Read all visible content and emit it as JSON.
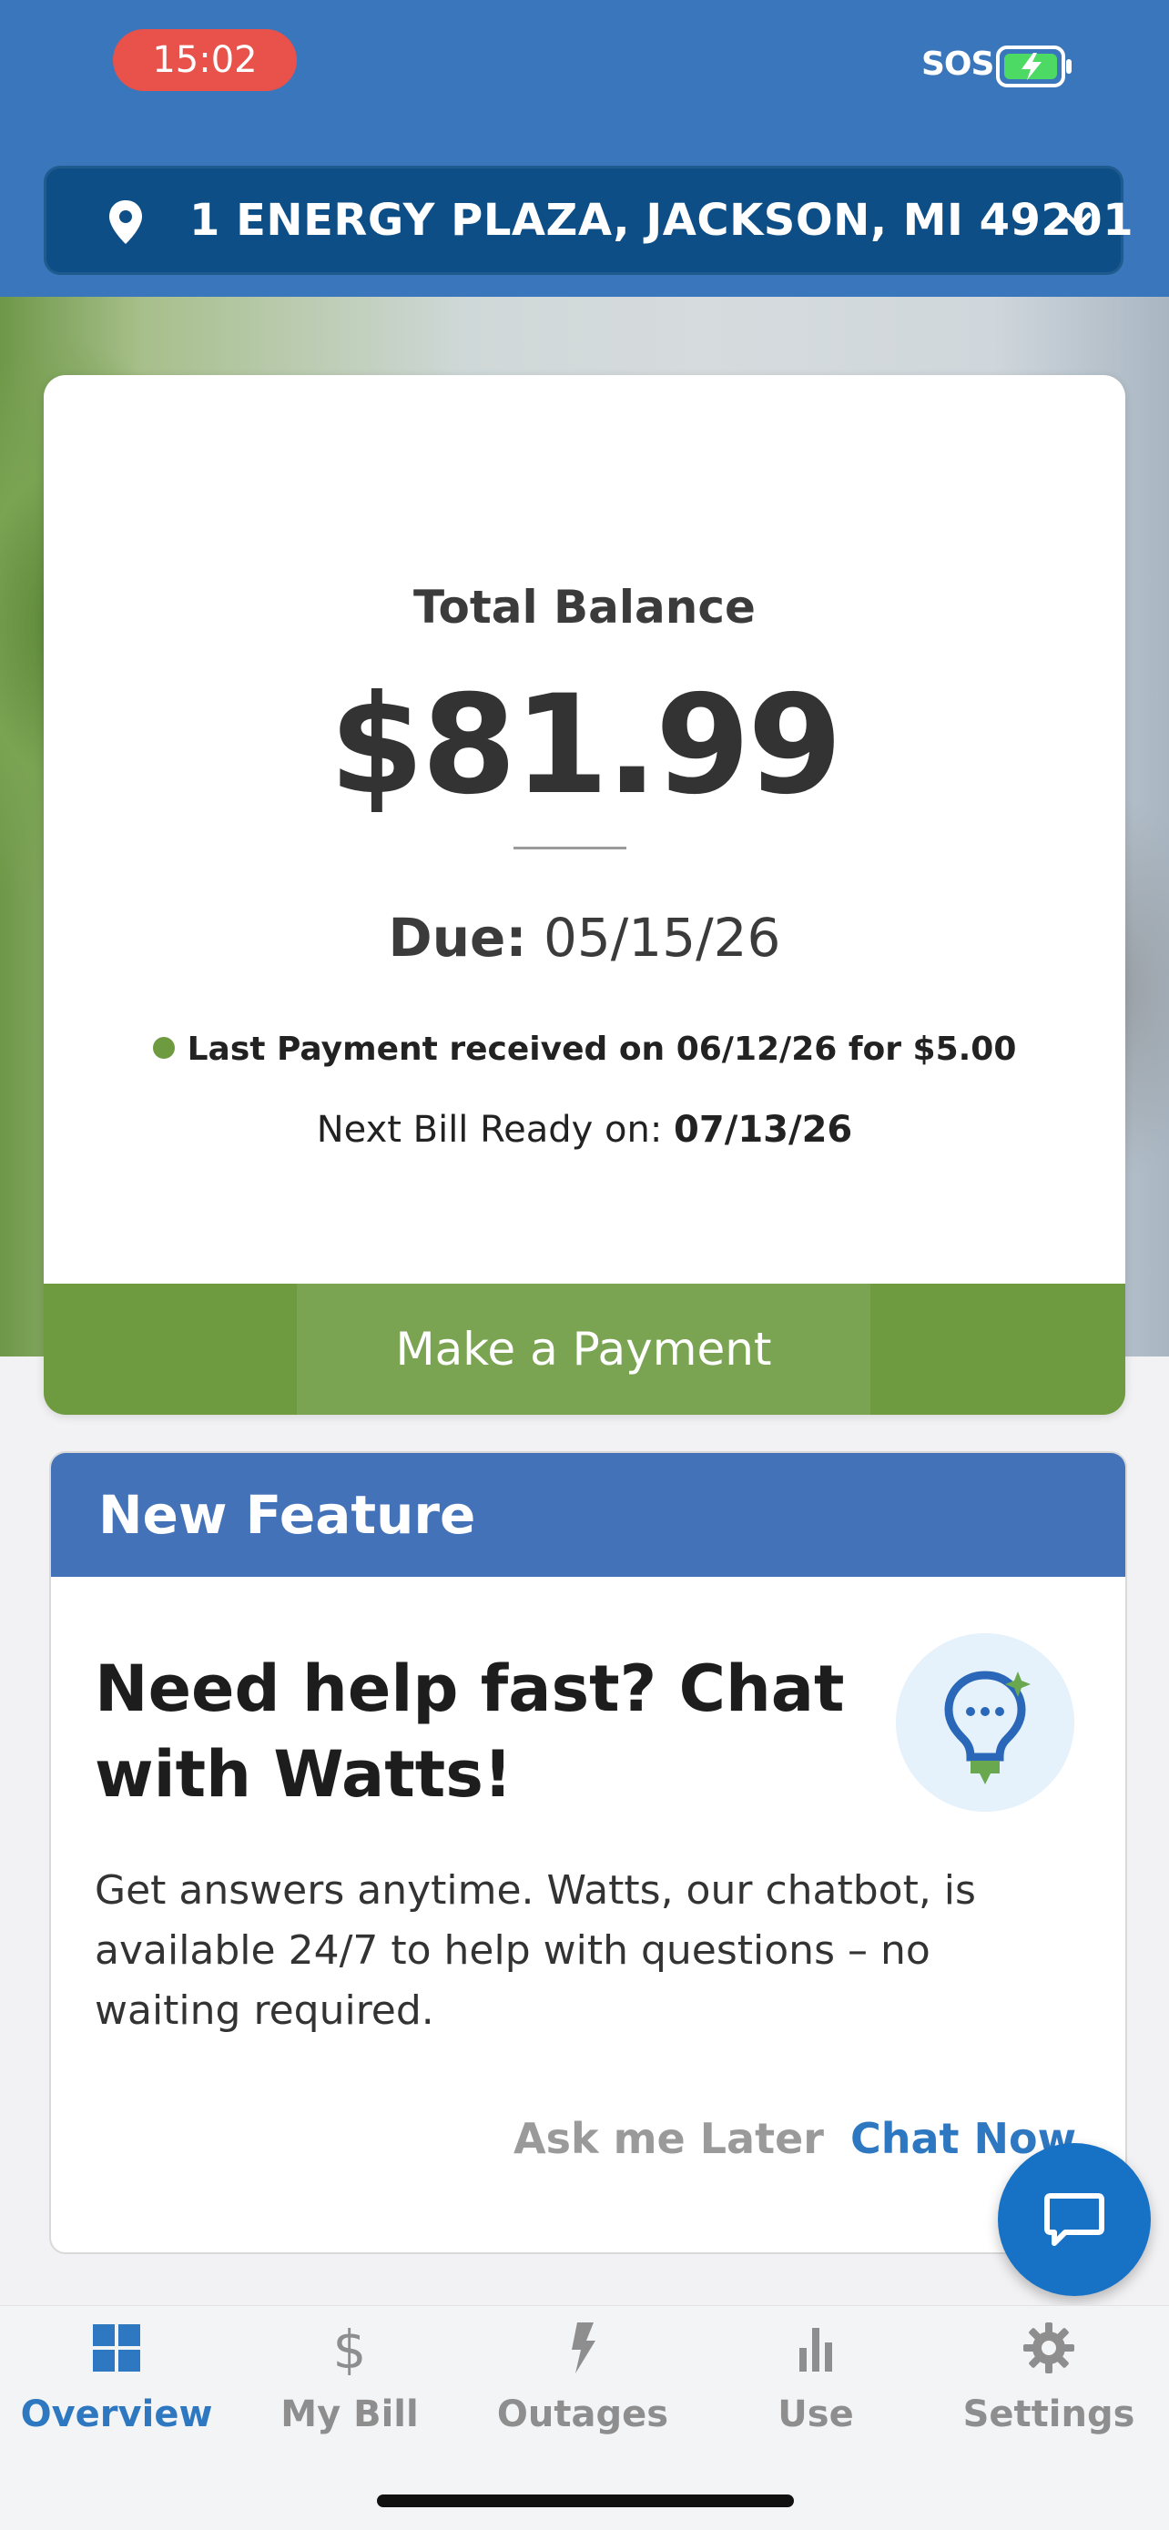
{
  "status_bar": {
    "time": "15:02",
    "sos": "SOS"
  },
  "address": {
    "value": "1 ENERGY PLAZA, JACKSON, MI 49201"
  },
  "balance": {
    "label": "Total Balance",
    "amount": "$81.99",
    "due_label": "Due:",
    "due_date": "05/15/26",
    "last_payment_text": "Last Payment received on 06/12/26 for $5.00",
    "next_bill_label": "Next Bill Ready on: ",
    "next_bill_date": "07/13/26",
    "payment_button_label": "Make a Payment"
  },
  "feature": {
    "header_title": "New Feature",
    "title": "Need help fast? Chat with Watts!",
    "body": "Get answers anytime. Watts, our chatbot, is available 24/7 to help with questions – no waiting required.",
    "later_label": "Ask me Later",
    "chat_label": "Chat Now"
  },
  "tabs": [
    {
      "label": "Overview",
      "icon": "grid-icon",
      "active": true
    },
    {
      "label": "My Bill",
      "icon": "dollar-icon",
      "active": false
    },
    {
      "label": "Outages",
      "icon": "lightning-icon",
      "active": false
    },
    {
      "label": "Use",
      "icon": "bar-chart-icon",
      "active": false
    },
    {
      "label": "Settings",
      "icon": "gear-icon",
      "active": false
    }
  ],
  "colors": {
    "header_blue": "#3a76bb",
    "address_bar": "#0d4e86",
    "green": "#6e9b40",
    "feature_header": "#4472b8",
    "accent_blue": "#2e78c1",
    "fab_blue": "#1772c6"
  }
}
